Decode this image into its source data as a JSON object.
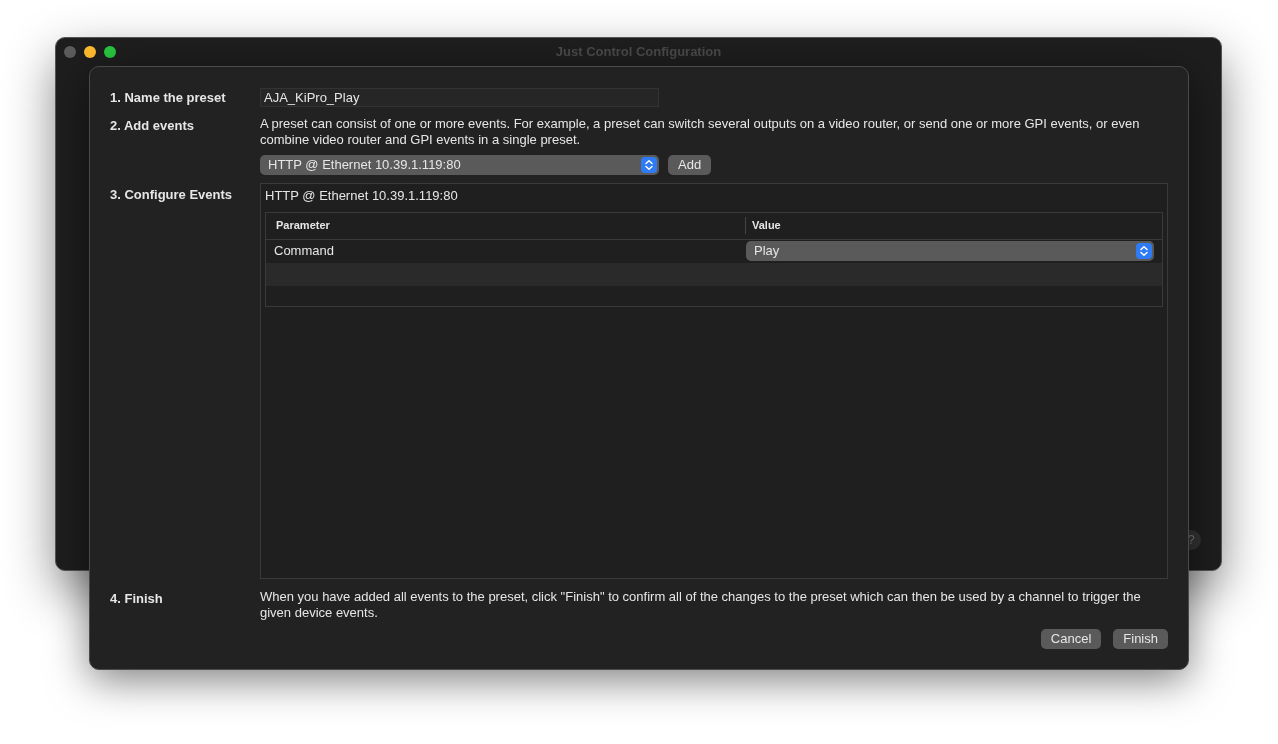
{
  "window": {
    "title": "Just Control Configuration",
    "help_button": "?"
  },
  "sheet": {
    "step_1": {
      "label": "1. Name the preset",
      "name_field": {
        "value": "AJA_KiPro_Play"
      }
    },
    "step_2": {
      "label": "2. Add events",
      "description": "A preset can consist of one or more events. For example, a preset can switch several outputs on a video router, or send one or more GPI events, or even combine video router and GPI events in a single preset.",
      "device_select": {
        "value": "HTTP @ Ethernet 10.39.1.119:80"
      },
      "add_button": "Add"
    },
    "step_3": {
      "label": "3. Configure Events",
      "event_title": "HTTP @ Ethernet 10.39.1.119:80",
      "table": {
        "columns": [
          "Parameter",
          "Value"
        ],
        "rows": [
          {
            "parameter": "Command",
            "value": "Play"
          }
        ]
      }
    },
    "step_4": {
      "label": "4. Finish",
      "description": "When you have added all events to the preset, click \"Finish\" to confirm all of the changes to the preset which can then be used by a channel to trigger the given device events."
    },
    "buttons": [
      "Cancel",
      "Finish"
    ]
  }
}
